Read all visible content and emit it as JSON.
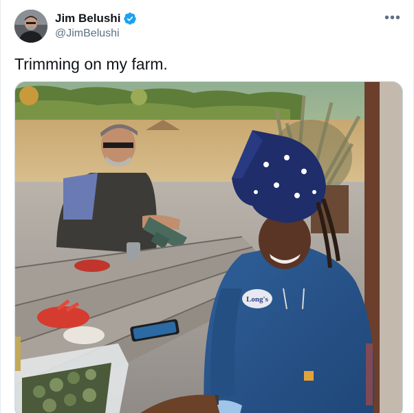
{
  "author": {
    "display_name": "Jim Belushi",
    "handle": "@JimBelushi",
    "verified": true,
    "verified_color": "#1da1f2",
    "avatar_icon": "profile-photo"
  },
  "more_menu": {
    "label": "•••",
    "icon": "more-horizontal-icon"
  },
  "tweet": {
    "text": "Trimming on my farm."
  },
  "media": {
    "type": "photo",
    "icon": "photo",
    "logo_text": "Long's"
  }
}
